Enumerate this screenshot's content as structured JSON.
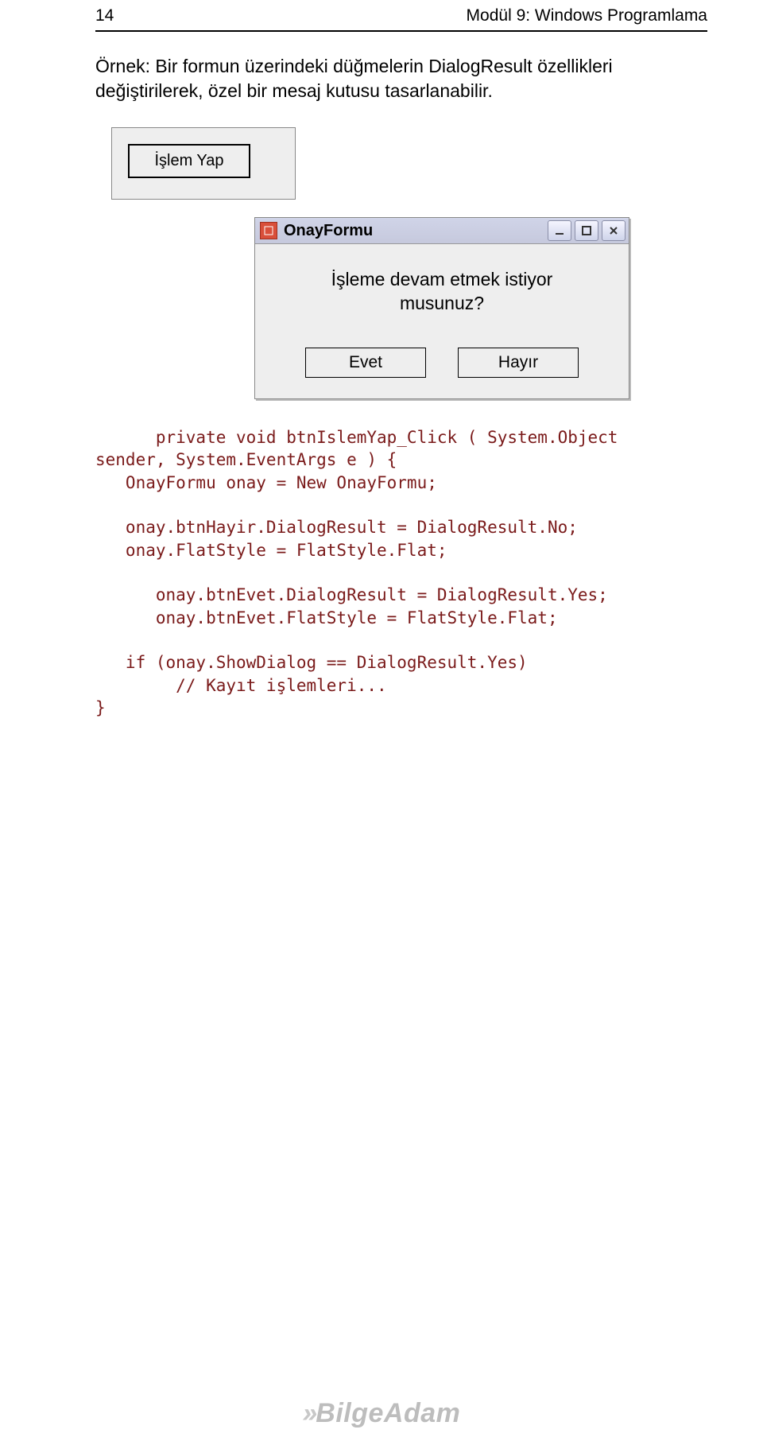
{
  "page_number": "14",
  "header_title": "Modül 9: Windows Programlama",
  "intro_text": "Örnek: Bir formun üzerindeki düğmelerin DialogResult özellikleri değiştirilerek, özel bir mesaj kutusu tasarlanabilir.",
  "window1": {
    "button_label": "İşlem Yap"
  },
  "window2": {
    "title": "OnayFormu",
    "message_line1": "İşleme devam etmek istiyor",
    "message_line2": "musunuz?",
    "btn_yes": "Evet",
    "btn_no": "Hayır"
  },
  "code": {
    "l1": "      private void btnIslemYap_Click ( System.Object",
    "l2": "sender, System.EventArgs e ) {",
    "l3": "   OnayFormu onay = New OnayFormu;",
    "l4": "",
    "l5": "   onay.btnHayir.DialogResult = DialogResult.No;",
    "l6": "   onay.FlatStyle = FlatStyle.Flat;",
    "l7": "",
    "l8": "      onay.btnEvet.DialogResult = DialogResult.Yes;",
    "l9": "      onay.btnEvet.FlatStyle = FlatStyle.Flat;",
    "l10": "",
    "l11": "   if (onay.ShowDialog == DialogResult.Yes)",
    "l12": "        // Kayıt işlemleri...",
    "l13": "}"
  },
  "footer_brand": "BilgeAdam"
}
